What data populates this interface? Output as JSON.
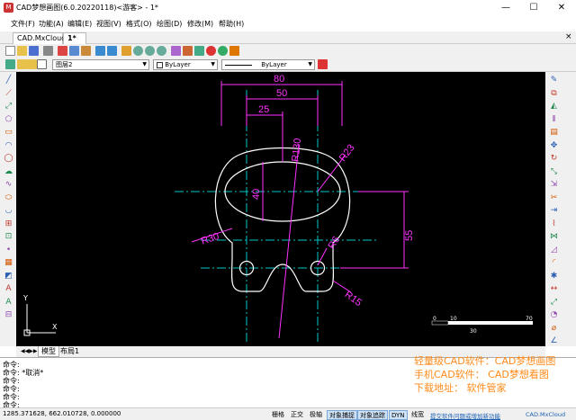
{
  "window": {
    "title": "CAD梦想画图(6.0.20220118)<游客> - 1*",
    "minimize_glyph": "—",
    "maximize_glyph": "☐",
    "close_glyph": "✕"
  },
  "menu": [
    "文件(F)",
    "功能(A)",
    "编辑(E)",
    "视图(V)",
    "格式(O)",
    "绘图(D)",
    "修改(M)",
    "帮助(H)"
  ],
  "tabs": [
    {
      "label": "CAD.MxCloud"
    },
    {
      "label": "1*"
    }
  ],
  "tab_close_glyph": "×",
  "properties": {
    "layer": "图层2",
    "color": "ByLayer",
    "linetype": "ByLayer"
  },
  "layout_tabs": [
    "模型",
    "布局1"
  ],
  "drawing": {
    "dimensions": [
      "80",
      "50",
      "25",
      "40",
      "55"
    ],
    "radii": [
      "R130",
      "R23",
      "R30",
      "R6",
      "R15"
    ],
    "scale_bar": {
      "ticks": [
        "0",
        "10",
        "30",
        "70"
      ]
    },
    "ucs_labels": {
      "x": "X",
      "y": "Y"
    }
  },
  "command_lines": [
    "命令:",
    "命令:  *取消*",
    "命令:",
    "命令:",
    "命令:",
    "命令:"
  ],
  "promo_lines": [
    "轻量级CAD软件：CAD梦想画图",
    "手机CAD软件： CAD梦想看图",
    "下载地址：      软件管家"
  ],
  "status": {
    "coords": "1285.371628,  662.010728,  0.000000",
    "toggles": [
      {
        "label": "栅格",
        "on": false
      },
      {
        "label": "正交",
        "on": false
      },
      {
        "label": "极轴",
        "on": false
      },
      {
        "label": "对象捕捉",
        "on": true
      },
      {
        "label": "对象追踪",
        "on": true
      },
      {
        "label": "DYN",
        "on": true
      },
      {
        "label": "线宽",
        "on": false
      }
    ],
    "feedback": "提交软件问题或增加新功能",
    "brand": "CAD.MxCloud"
  },
  "colors": {
    "canvas": "#000000",
    "dimension": "#ff33ff",
    "centerline": "#00c8c8",
    "geometry": "#ffffff",
    "promo": "#ff8a1a"
  },
  "icons": {
    "left_toolbar": [
      "line-icon",
      "polyline-icon",
      "construction-line-icon",
      "polygon-icon",
      "rectangle-icon",
      "arc-icon",
      "circle-icon",
      "cloud-icon",
      "spline-icon",
      "ellipse-icon",
      "ellipse-arc-icon",
      "insert-block-icon",
      "make-block-icon",
      "point-icon",
      "hatch-icon",
      "region-icon",
      "text-icon",
      "mtext-icon",
      "table-icon"
    ],
    "right_toolbar": [
      "erase-icon",
      "copy-icon",
      "mirror-icon",
      "offset-icon",
      "array-icon",
      "move-icon",
      "rotate-icon",
      "scale-icon",
      "stretch-icon",
      "trim-icon",
      "extend-icon",
      "break-icon",
      "join-icon",
      "chamfer-icon",
      "fillet-icon",
      "explode-icon",
      "dim-linear-icon",
      "dim-aligned-icon",
      "dim-radius-icon",
      "dim-diameter-icon",
      "dim-angular-icon"
    ]
  }
}
